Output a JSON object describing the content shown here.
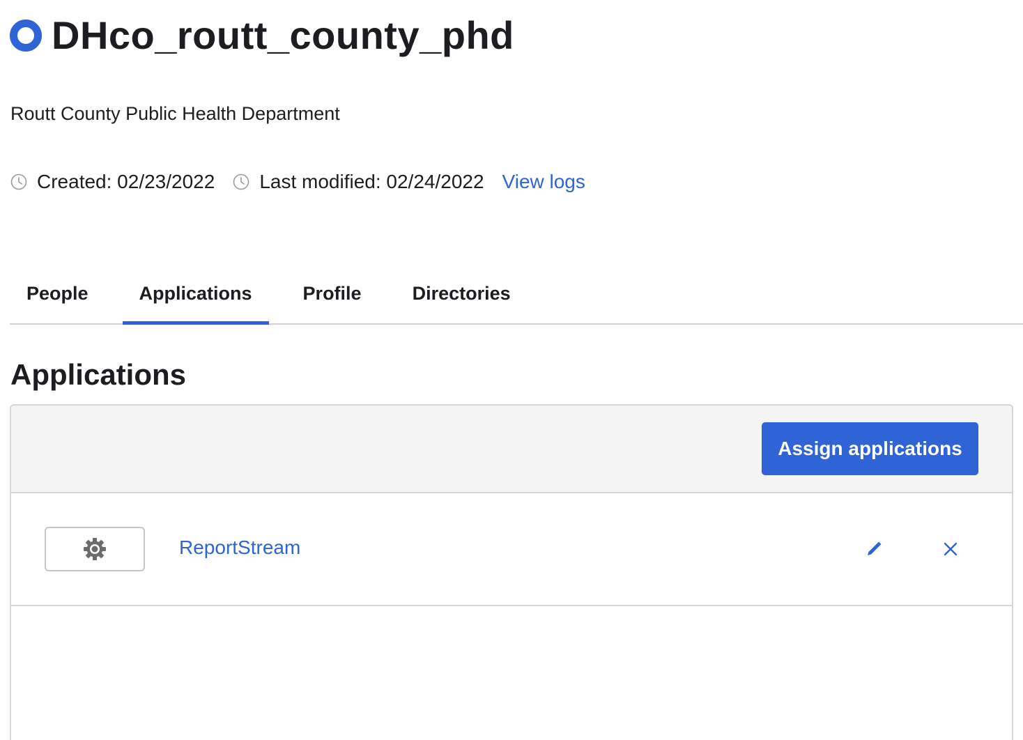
{
  "header": {
    "title": "DHco_routt_county_phd",
    "description": "Routt County Public Health Department",
    "created": "Created: 02/23/2022",
    "last_modified": "Last modified: 02/24/2022",
    "view_logs": "View logs"
  },
  "tabs": [
    {
      "label": "People",
      "active": false
    },
    {
      "label": "Applications",
      "active": true
    },
    {
      "label": "Profile",
      "active": false
    },
    {
      "label": "Directories",
      "active": false
    }
  ],
  "section": {
    "title": "Applications",
    "assign_button": "Assign applications"
  },
  "applications": [
    {
      "name": "ReportStream",
      "logo_icon": "gear-icon"
    }
  ],
  "colors": {
    "accent": "#2e64d6",
    "text": "#1d1d21",
    "toolbar_bg": "#f4f4f4",
    "border": "#d6d6d6"
  }
}
